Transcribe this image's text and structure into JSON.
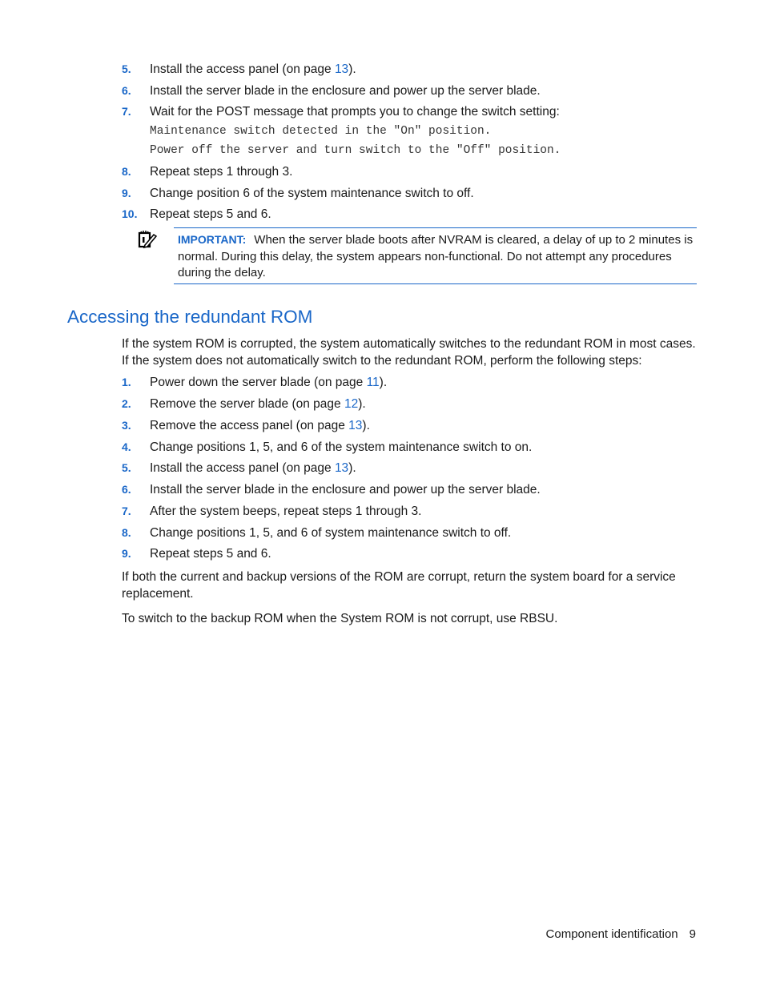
{
  "top_steps": [
    {
      "num": "5.",
      "text_before": "Install the access panel (on page ",
      "link": "13",
      "text_after": ")."
    },
    {
      "num": "6.",
      "text": "Install the server blade in the enclosure and power up the server blade."
    },
    {
      "num": "7.",
      "text": "Wait for the POST message that prompts you to change the switch setting:"
    },
    {
      "num": "8.",
      "text": "Repeat steps 1 through 3."
    },
    {
      "num": "9.",
      "text": "Change position 6 of the system maintenance switch to off."
    },
    {
      "num": "10.",
      "text": "Repeat steps 5 and 6."
    }
  ],
  "post_message": [
    "Maintenance switch detected in the \"On\" position.",
    "Power off the server and turn switch to the \"Off\" position."
  ],
  "important_note": {
    "icon": "important-note-icon",
    "label": "IMPORTANT:",
    "text": "When the server blade boots after NVRAM is cleared, a delay of up to 2 minutes is normal. During this delay, the system appears non-functional. Do not attempt any procedures during the delay."
  },
  "section": {
    "heading": "Accessing the redundant ROM",
    "intro": "If the system ROM is corrupted, the system automatically switches to the redundant ROM in most cases. If the system does not automatically switch to the redundant ROM, perform the following steps:",
    "steps": [
      {
        "num": "1.",
        "text_before": "Power down the server blade (on page ",
        "link": "11",
        "text_after": ")."
      },
      {
        "num": "2.",
        "text_before": "Remove the server blade (on page ",
        "link": "12",
        "text_after": ")."
      },
      {
        "num": "3.",
        "text_before": "Remove the access panel (on page ",
        "link": "13",
        "text_after": ")."
      },
      {
        "num": "4.",
        "text": "Change positions 1, 5, and 6 of the system maintenance switch to on."
      },
      {
        "num": "5.",
        "text_before": "Install the access panel (on page ",
        "link": "13",
        "text_after": ")."
      },
      {
        "num": "6.",
        "text": "Install the server blade in the enclosure and power up the server blade."
      },
      {
        "num": "7.",
        "text": "After the system beeps, repeat steps 1 through 3."
      },
      {
        "num": "8.",
        "text": "Change positions 1, 5, and 6 of system maintenance switch to off."
      },
      {
        "num": "9.",
        "text": "Repeat steps 5 and 6."
      }
    ],
    "para_corrupt": "If both the current and backup versions of the ROM are corrupt, return the system board for a service replacement.",
    "para_rbsu": "To switch to the backup ROM when the System ROM is not corrupt, use RBSU."
  },
  "footer": {
    "section": "Component identification",
    "page": "9"
  },
  "colors": {
    "accent": "#1a67c8",
    "text": "#1a1a1a"
  }
}
